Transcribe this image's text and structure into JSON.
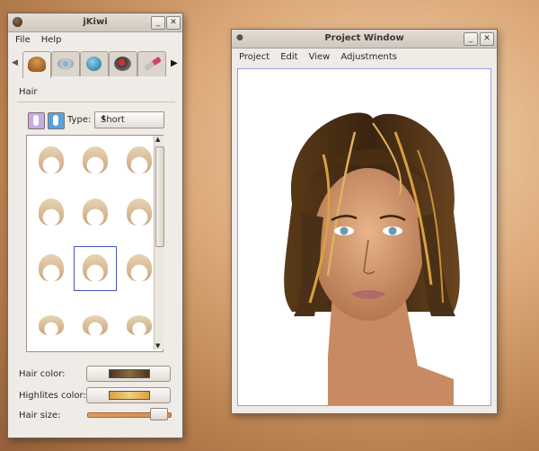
{
  "kiwi_window": {
    "title": "jKiwi",
    "menus": [
      "File",
      "Help"
    ],
    "tabs": [
      {
        "name": "hair",
        "icon": "hair-icon"
      },
      {
        "name": "eyes",
        "icon": "eye-icon"
      },
      {
        "name": "color",
        "icon": "color-icon"
      },
      {
        "name": "makeup",
        "icon": "makeup-icon"
      },
      {
        "name": "lipstick",
        "icon": "lipstick-icon"
      }
    ],
    "section": "Hair",
    "type_label": "Type:",
    "type_value": "Short",
    "hair_color_label": "Hair color:",
    "highlites_color_label": "Highlites color:",
    "hair_size_label": "Hair size:",
    "hair_color": "#4a3420",
    "highlites_color": "#d9a040",
    "hair_size": 0.85
  },
  "project_window": {
    "title": "Project Window",
    "menus": [
      "Project",
      "Edit",
      "View",
      "Adjustments"
    ]
  }
}
